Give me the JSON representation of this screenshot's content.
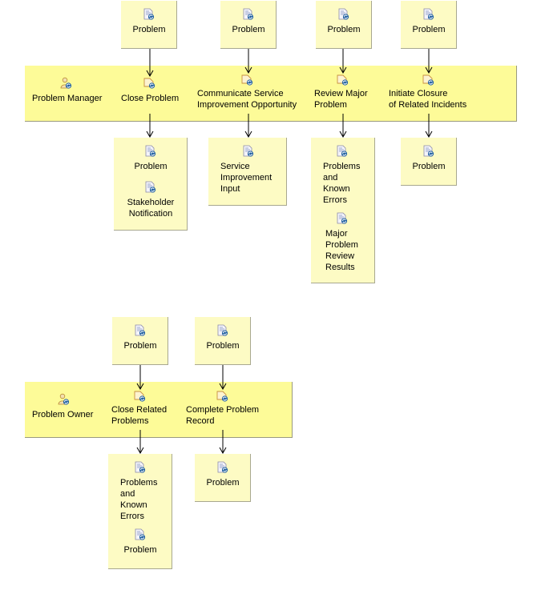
{
  "diagram_1": {
    "role": "Problem Manager",
    "tasks": [
      {
        "label": "Close Problem",
        "inputs": [
          "Problem"
        ],
        "outputs": [
          "Problem",
          "Stakeholder\nNotification"
        ]
      },
      {
        "label": "Communicate Service\nImprovement Opportunity",
        "inputs": [
          "Problem"
        ],
        "outputs": [
          "Service\nImprovement\nInput"
        ]
      },
      {
        "label": "Review Major\nProblem",
        "inputs": [
          "Problem"
        ],
        "outputs": [
          "Problems\nand\nKnown\nErrors",
          "Major\nProblem\nReview\nResults"
        ]
      },
      {
        "label": "Initiate Closure\nof Related Incidents",
        "inputs": [
          "Problem"
        ],
        "outputs": [
          "Problem"
        ]
      }
    ]
  },
  "diagram_2": {
    "role": "Problem Owner",
    "tasks": [
      {
        "label": "Close Related\nProblems",
        "inputs": [
          "Problem"
        ],
        "outputs": [
          "Problems\nand\nKnown\nErrors",
          "Problem"
        ]
      },
      {
        "label": "Complete Problem\nRecord",
        "inputs": [
          "Problem"
        ],
        "outputs": [
          "Problem"
        ]
      }
    ]
  },
  "icons": {
    "role": "role-icon",
    "task": "task-icon",
    "work_product": "work-product-icon"
  },
  "colors": {
    "lane_fill": "#fdfb98",
    "artifact_fill": "#fdfbc4",
    "border": "#9a9a80",
    "arrow": "#000000"
  }
}
